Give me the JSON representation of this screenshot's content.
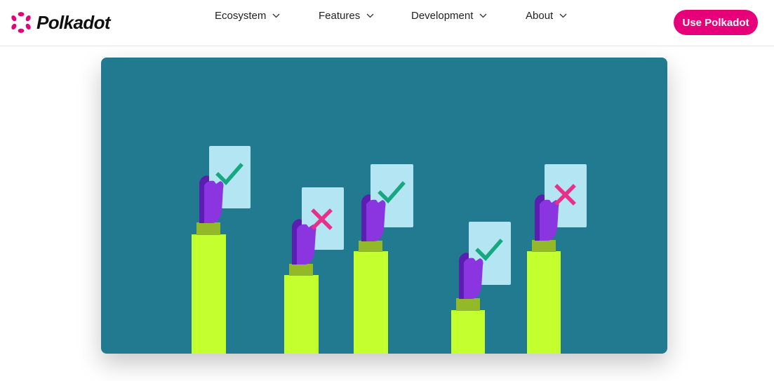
{
  "header": {
    "brand_name": "Polkadot",
    "nav": [
      {
        "label": "Ecosystem"
      },
      {
        "label": "Features"
      },
      {
        "label": "Development"
      },
      {
        "label": "About"
      }
    ],
    "cta_label": "Use Polkadot"
  },
  "colors": {
    "brand_pink": "#e6007a",
    "hero_background": "#217a90",
    "arm_lime": "#c4ff2e",
    "cuff_olive": "#93b828",
    "hand_purple": "#8a35e0",
    "card_light_blue": "#b3e6f2",
    "check_green": "#17a882",
    "cross_pink": "#e8308a"
  },
  "illustration": {
    "votes": [
      {
        "mark": "check-icon"
      },
      {
        "mark": "cross-icon"
      },
      {
        "mark": "check-icon"
      },
      {
        "mark": "check-icon"
      },
      {
        "mark": "cross-icon"
      }
    ]
  }
}
